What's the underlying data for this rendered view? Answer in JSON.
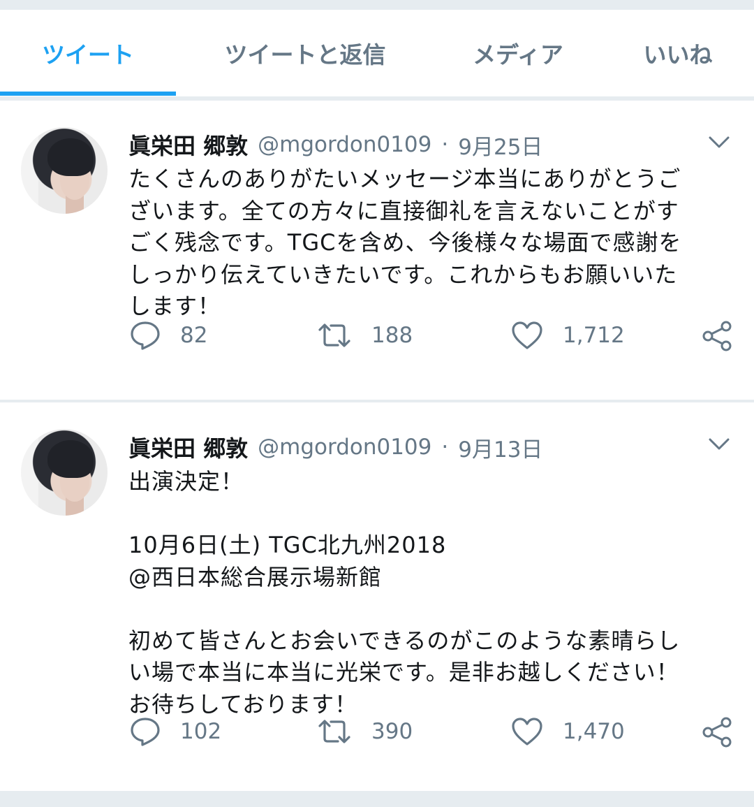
{
  "tabs": [
    {
      "label": "ツイート",
      "active": true
    },
    {
      "label": "ツイートと返信",
      "active": false
    },
    {
      "label": "メディア",
      "active": false
    },
    {
      "label": "いいね",
      "active": false
    }
  ],
  "colors": {
    "accent": "#1da1f2",
    "muted": "#657786",
    "text": "#14171a",
    "divider": "#e6ecf0"
  },
  "icons": [
    "chevron-down-icon",
    "reply-icon",
    "retweet-icon",
    "heart-icon",
    "share-icon"
  ],
  "tweets": [
    {
      "name": "眞栄田 郷敦",
      "handle": "@mgordon0109",
      "separator": "·",
      "date": "9月25日",
      "text": "たくさんのありがたいメッセージ本当にありがとうご\nざいます。全ての方々に直接御礼を言えないことがす\nごく残念です。TGCを含め、今後様々な場面で感謝を\nしっかり伝えていきたいです。これからもお願いいた\nします！",
      "replies": "82",
      "retweets": "188",
      "likes": "1,712"
    },
    {
      "name": "眞栄田 郷敦",
      "handle": "@mgordon0109",
      "separator": "·",
      "date": "9月13日",
      "text": "出演決定！\n\n10月6日(土) TGC北九州2018\n@西日本総合展示場新館\n\n初めて皆さんとお会いできるのがこのような素晴らし\nい場で本当に本当に光栄です。是非お越しください！\nお待ちしております！",
      "replies": "102",
      "retweets": "390",
      "likes": "1,470"
    }
  ]
}
